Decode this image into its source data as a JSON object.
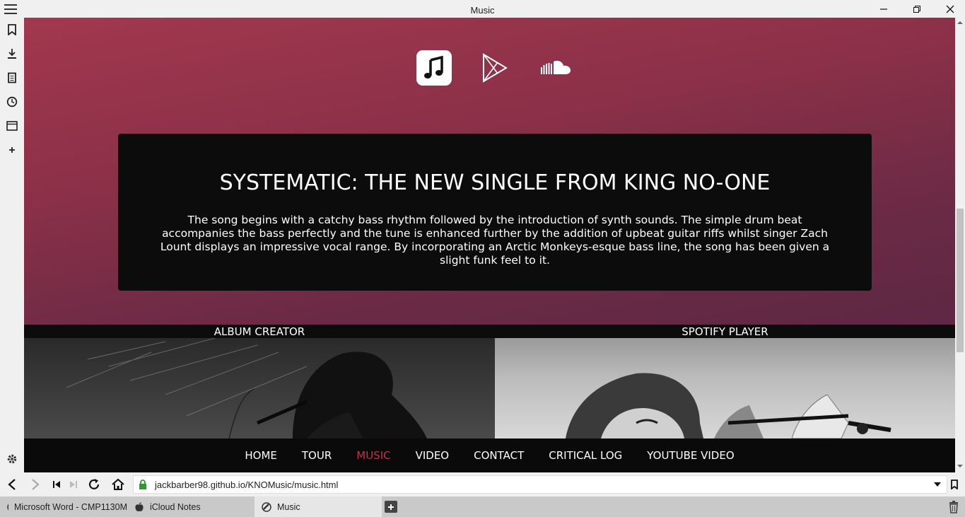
{
  "window": {
    "title": "Music"
  },
  "page": {
    "article": {
      "heading": "SYSTEMATIC: THE NEW SINGLE FROM KING NO-ONE",
      "body": "The song begins with a catchy bass rhythm followed by the introduction of synth sounds. The simple drum beat accompanies the bass perfectly and the tune is enhanced further by the addition of upbeat guitar riffs whilst singer Zach Lount displays an impressive vocal range. By incorporating an Arctic Monkeys-esque bass line, the song has been given a slight funk feel to it."
    },
    "cards": [
      {
        "label": "ALBUM CREATOR"
      },
      {
        "label": "SPOTIFY PLAYER"
      }
    ],
    "nav": [
      {
        "label": "HOME"
      },
      {
        "label": "TOUR"
      },
      {
        "label": "MUSIC"
      },
      {
        "label": "VIDEO"
      },
      {
        "label": "CONTACT"
      },
      {
        "label": "CRITICAL LOG"
      },
      {
        "label": "YOUTUBE VIDEO"
      }
    ],
    "nav_active_color": "#c2304a",
    "service_icons": [
      "apple-music-icon",
      "google-play-icon",
      "soundcloud-icon"
    ]
  },
  "addressbar": {
    "url": "jackbarber98.github.io/KNOMusic/music.html"
  },
  "tabs": [
    {
      "label": "Microsoft Word - CMP1130M"
    },
    {
      "label": "iCloud Notes"
    },
    {
      "label": "Music"
    }
  ]
}
